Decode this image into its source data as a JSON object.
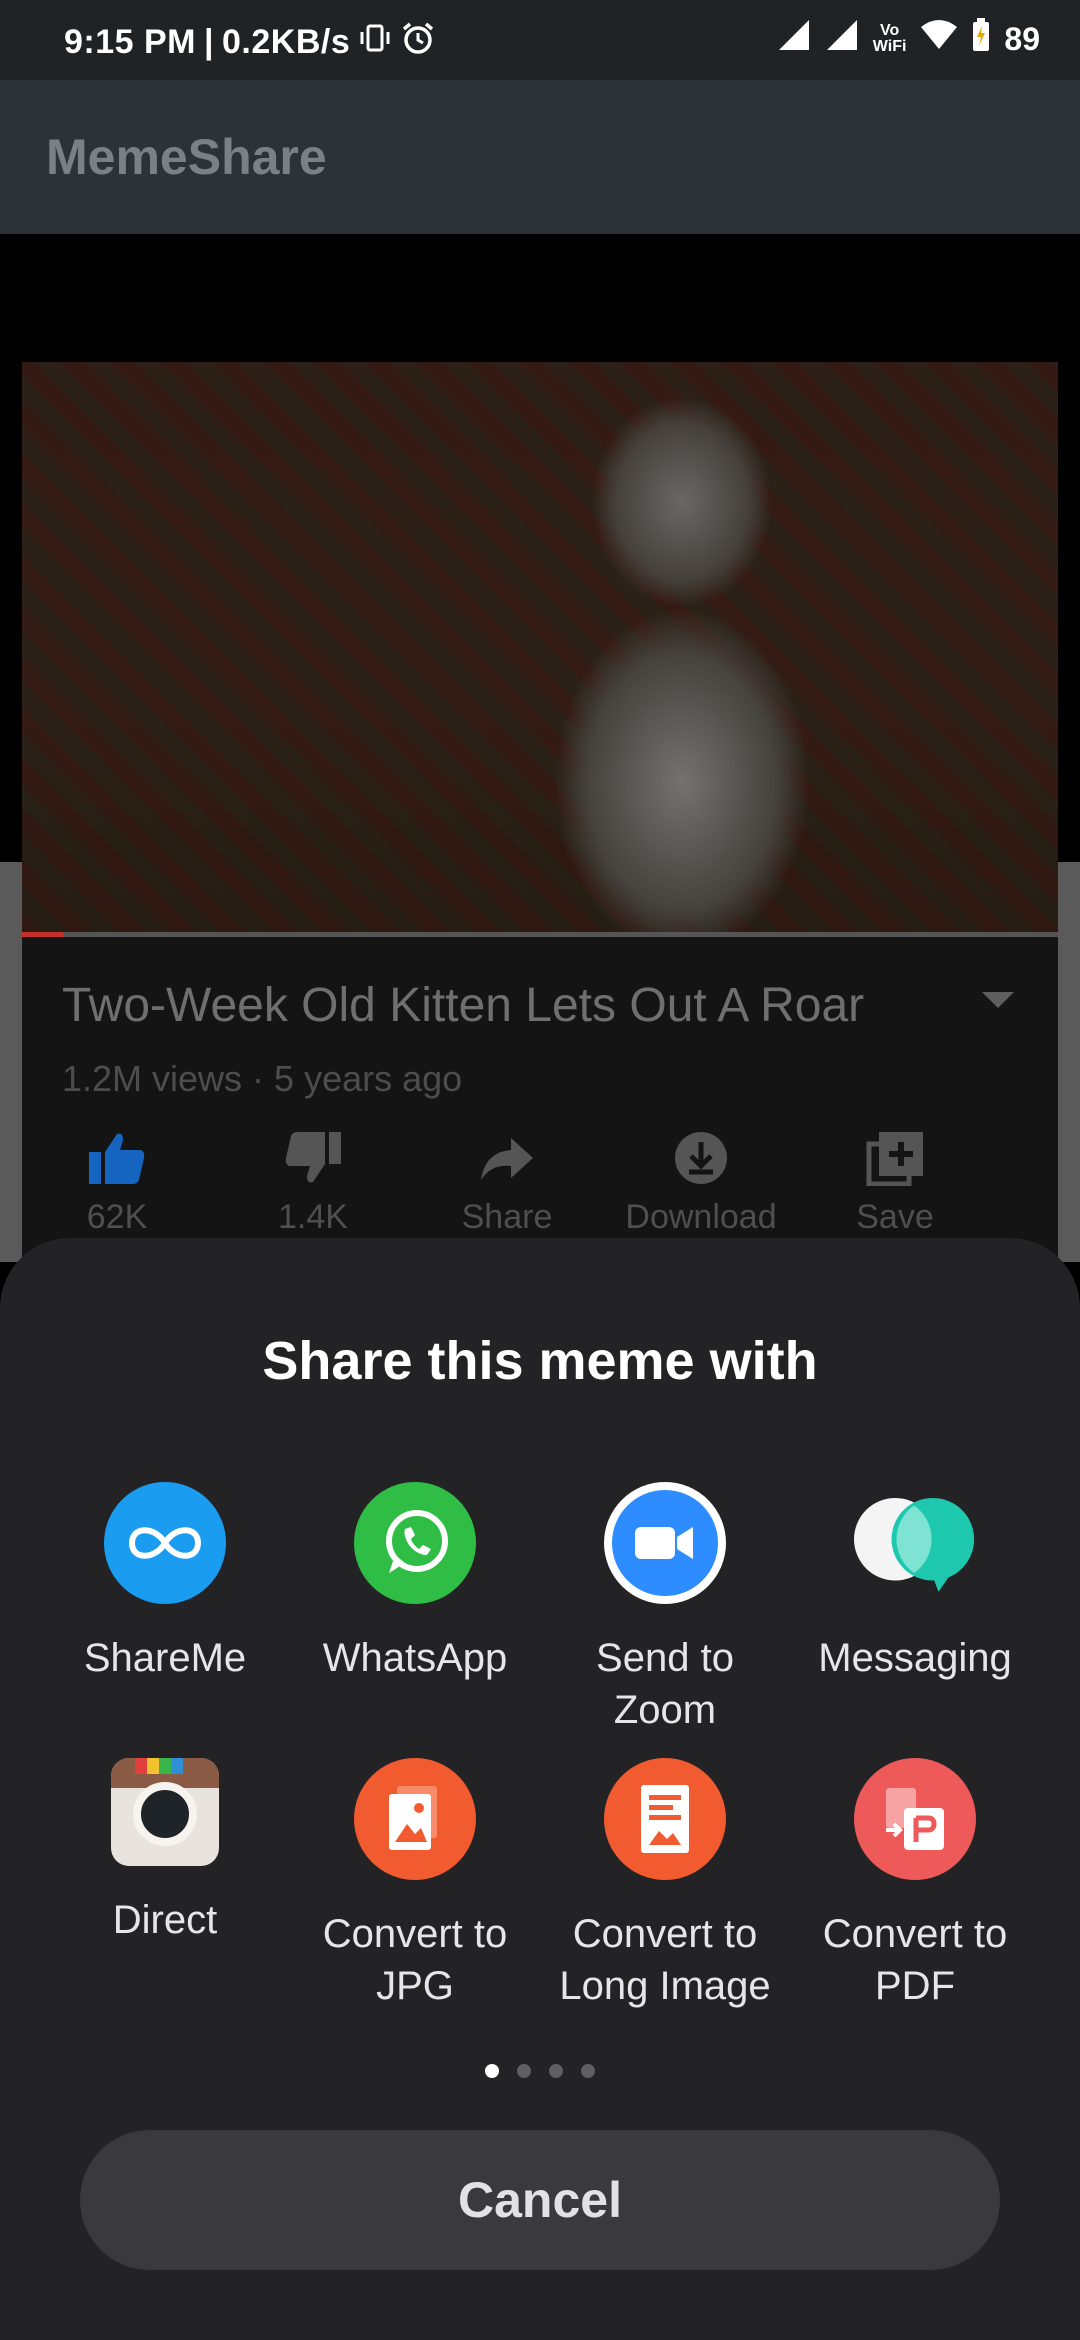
{
  "status": {
    "time": "9:15 PM",
    "speed": "0.2KB/s",
    "battery": "89",
    "vowifi": "Vo\nWiFi"
  },
  "app": {
    "title": "MemeShare"
  },
  "video": {
    "title": "Two-Week Old Kitten Lets Out A Roar",
    "meta": "1.2M views · 5 years ago",
    "progress_fraction": 0.04,
    "actions": [
      {
        "label": "62K",
        "icon": "thumbs-up-icon"
      },
      {
        "label": "1.4K",
        "icon": "thumbs-down-icon"
      },
      {
        "label": "Share",
        "icon": "share-arrow-icon"
      },
      {
        "label": "Download",
        "icon": "download-icon"
      },
      {
        "label": "Save",
        "icon": "add-to-playlist-icon"
      }
    ]
  },
  "sheet": {
    "title": "Share this meme with",
    "targets": [
      {
        "label": "ShareMe",
        "icon": "shareme-icon"
      },
      {
        "label": "WhatsApp",
        "icon": "whatsapp-icon"
      },
      {
        "label": "Send to Zoom",
        "icon": "zoom-icon"
      },
      {
        "label": "Messaging",
        "icon": "messaging-icon"
      },
      {
        "label": "Direct",
        "icon": "instagram-direct-icon"
      },
      {
        "label": "Convert to JPG",
        "icon": "convert-jpg-icon"
      },
      {
        "label": "Convert to Long Image",
        "icon": "convert-long-image-icon"
      },
      {
        "label": "Convert to PDF",
        "icon": "convert-pdf-icon"
      }
    ],
    "page_count": 4,
    "active_page": 1,
    "cancel_label": "Cancel"
  },
  "colors": {
    "sheet_bg": "#232325",
    "shareme": "#1a9cf0",
    "whatsapp": "#2fbd46",
    "zoom": "#2d8cff",
    "messaging": "#1ec8ae",
    "convert": "#f25a2f",
    "like_active": "#1565c0"
  }
}
